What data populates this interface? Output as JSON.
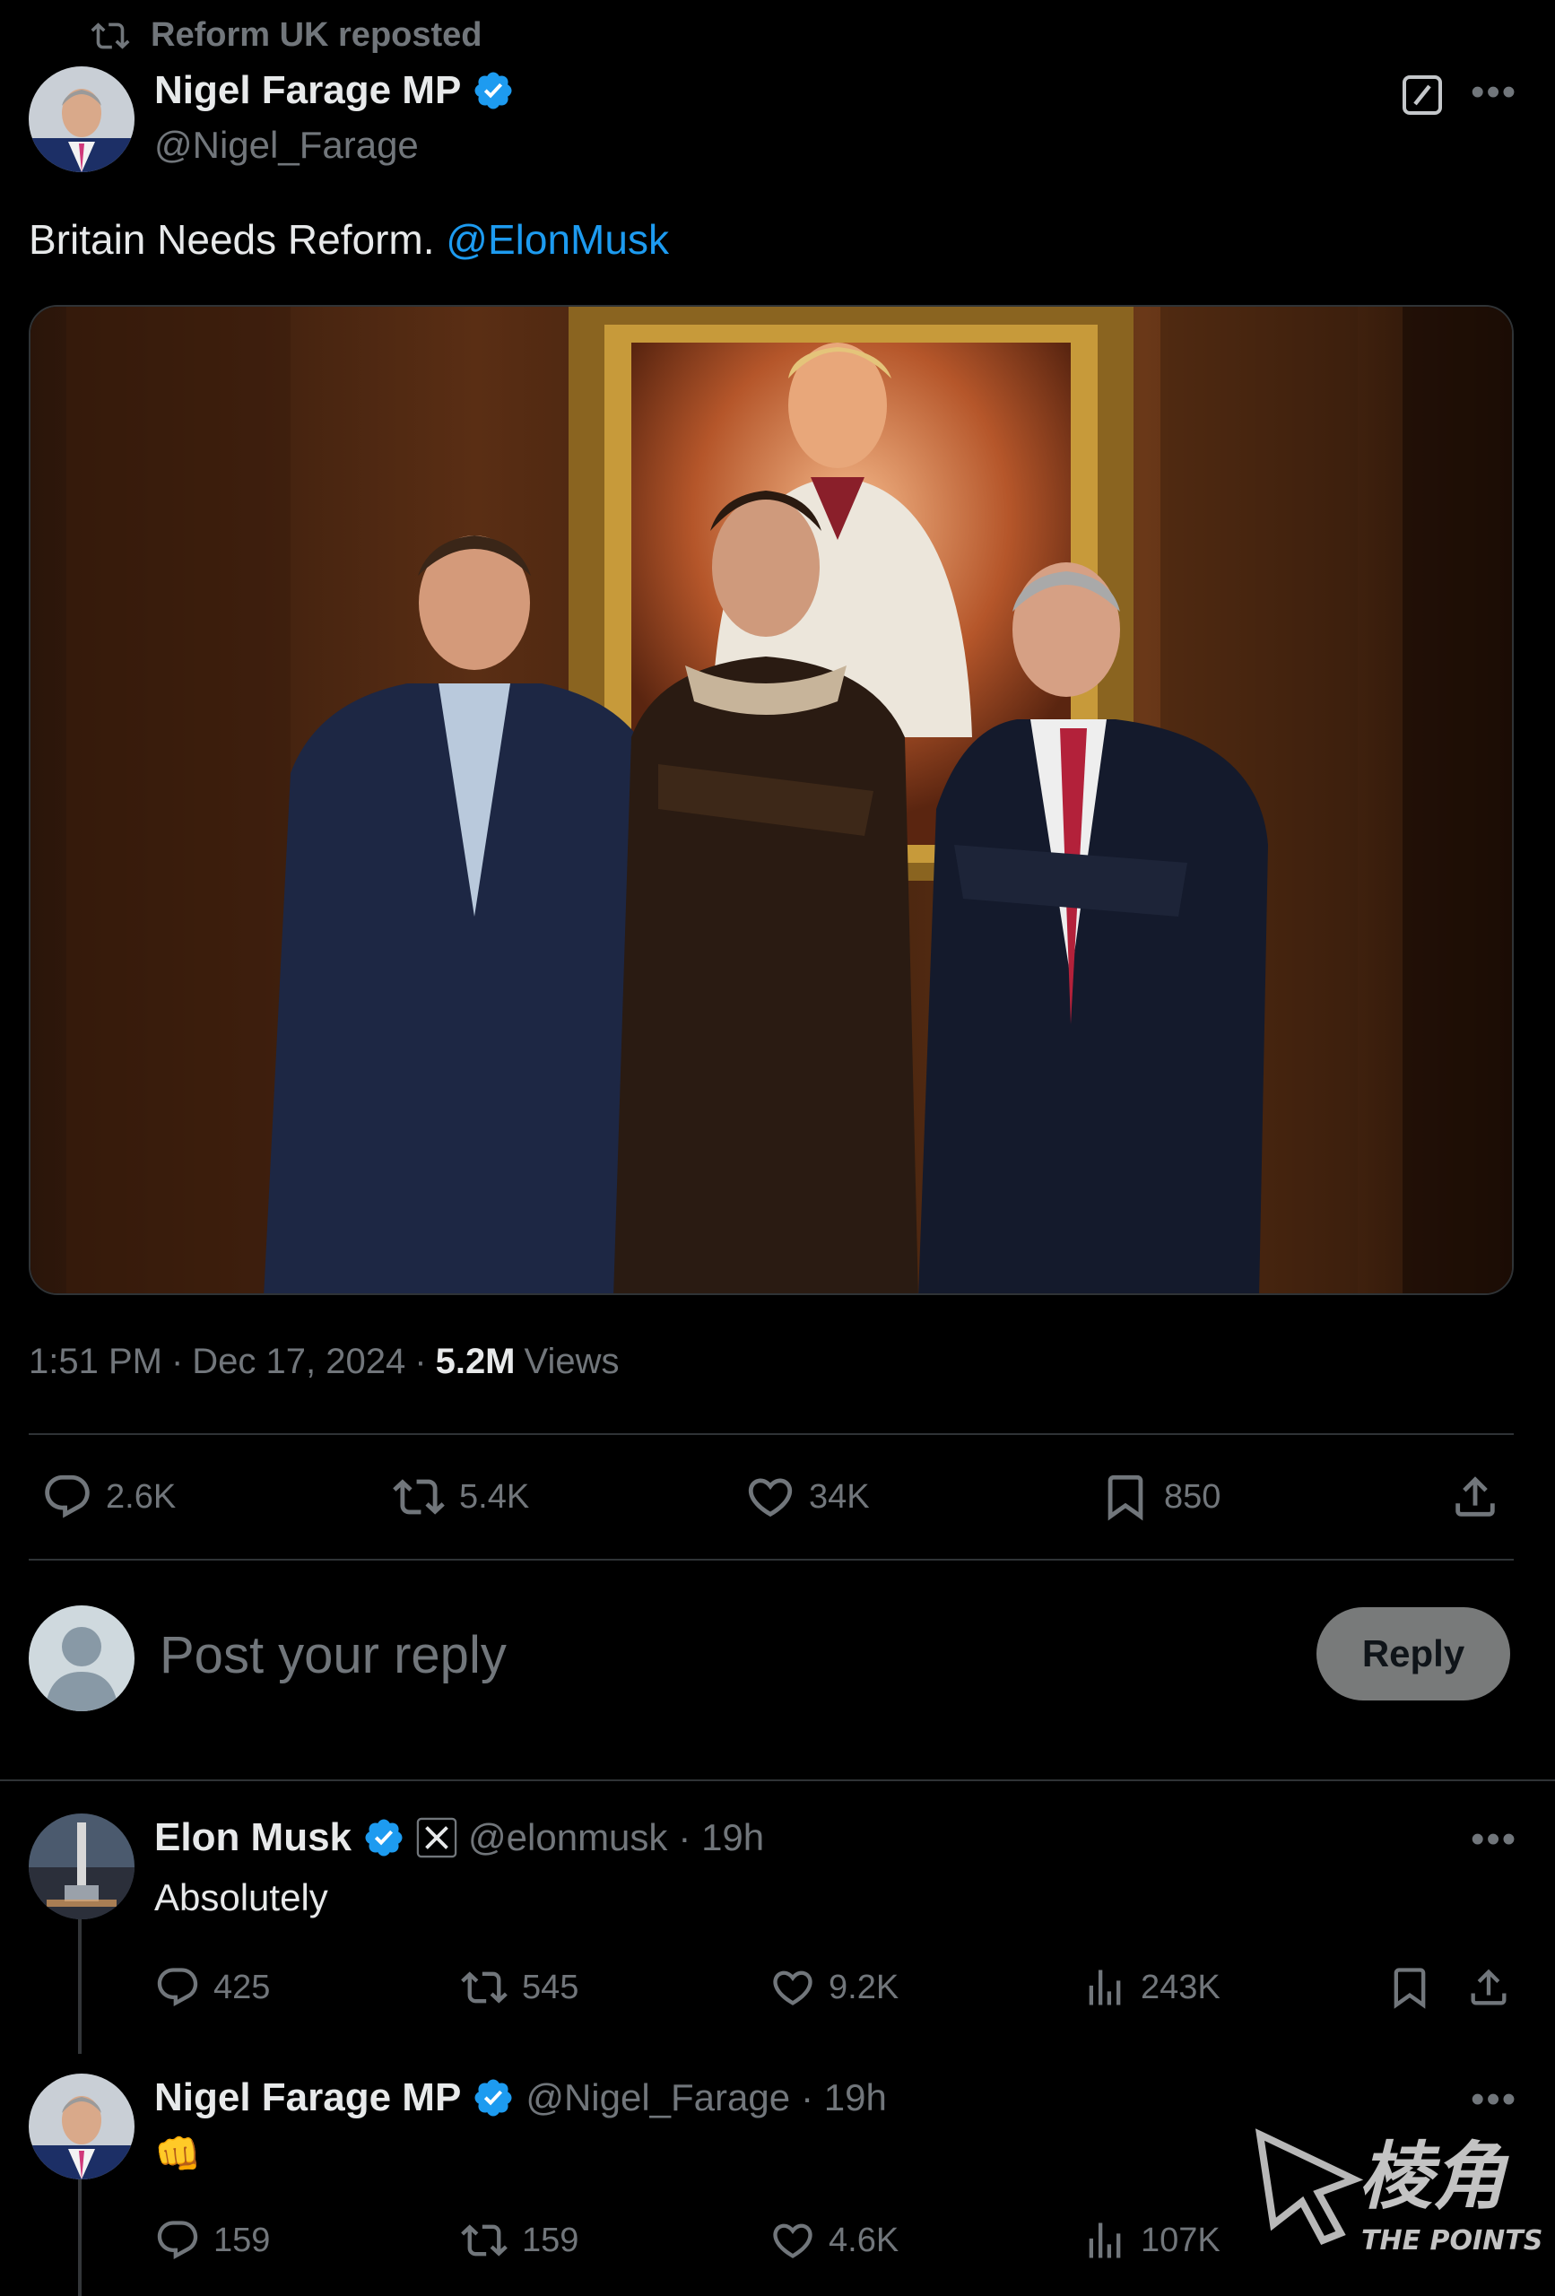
{
  "repost": {
    "label": "Reform UK reposted"
  },
  "main_tweet": {
    "author_name": "Nigel Farage MP",
    "author_handle": "@Nigel_Farage",
    "text_prefix": "Britain Needs Reform.",
    "mention": "@ElonMusk",
    "time": "1:51 PM",
    "date": "Dec 17, 2024",
    "views_count": "5.2M",
    "views_label": "Views",
    "replies": "2.6K",
    "reposts": "5.4K",
    "likes": "34K",
    "bookmarks": "850"
  },
  "reply_box": {
    "placeholder": "Post your reply",
    "button_label": "Reply"
  },
  "replies": [
    {
      "author_name": "Elon Musk",
      "author_handle": "@elonmusk",
      "age": "· 19h",
      "text": "Absolutely",
      "replies": "425",
      "reposts": "545",
      "likes": "9.2K",
      "views": "243K"
    },
    {
      "author_name": "Nigel Farage MP",
      "author_handle": "@Nigel_Farage",
      "age": "· 19h",
      "text": "👊",
      "replies": "159",
      "reposts": "159",
      "likes": "4.6K",
      "views": "107K"
    }
  ],
  "watermark": {
    "text_cn": "棱角",
    "text_en": "THE POINTS"
  },
  "colors": {
    "accent": "#1d9bf0",
    "background": "#000000",
    "muted": "#71767b",
    "divider": "#2f3336"
  }
}
